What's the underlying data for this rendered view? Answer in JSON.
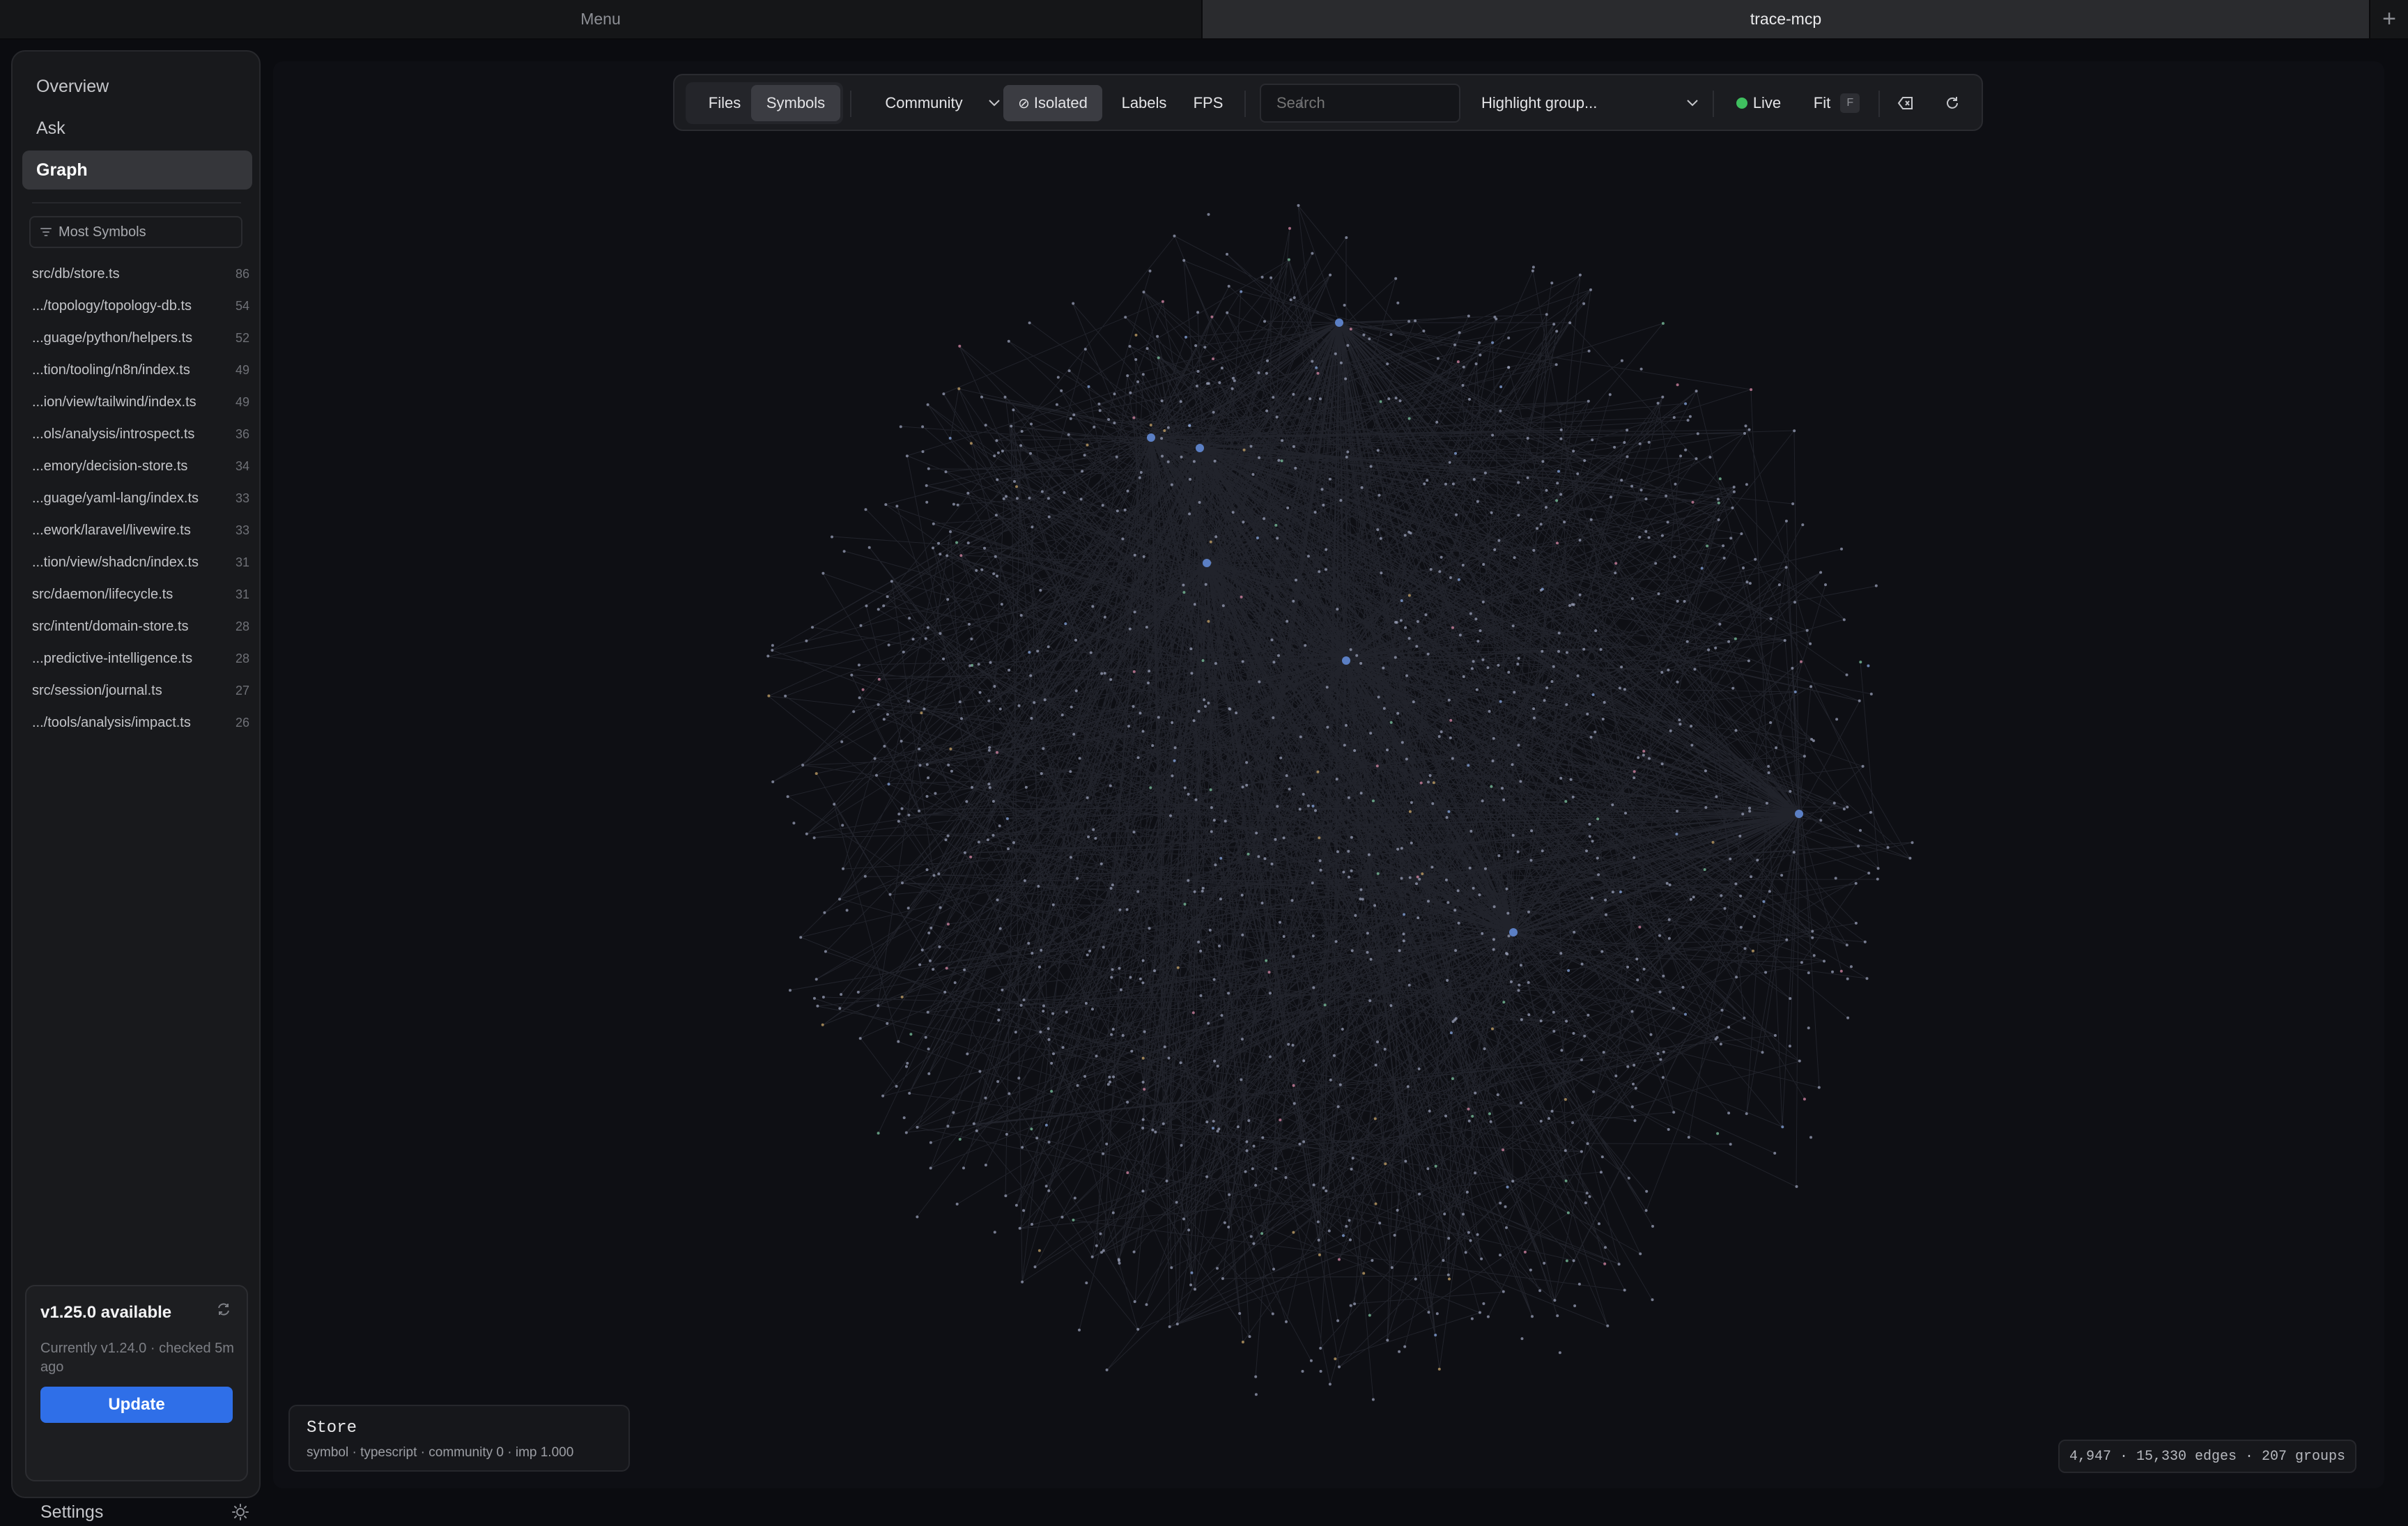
{
  "tabs": {
    "menu": "Menu",
    "active": "trace-mcp",
    "add": "+"
  },
  "sidebar": {
    "nav": [
      {
        "label": "Overview"
      },
      {
        "label": "Ask"
      },
      {
        "label": "Graph"
      }
    ],
    "sort_label": "Most Symbols",
    "files": [
      {
        "path": "src/db/store.ts",
        "count": "86"
      },
      {
        "path": ".../topology/topology-db.ts",
        "count": "54"
      },
      {
        "path": "...guage/python/helpers.ts",
        "count": "52"
      },
      {
        "path": "...tion/tooling/n8n/index.ts",
        "count": "49"
      },
      {
        "path": "...ion/view/tailwind/index.ts",
        "count": "49"
      },
      {
        "path": "...ols/analysis/introspect.ts",
        "count": "36"
      },
      {
        "path": "...emory/decision-store.ts",
        "count": "34"
      },
      {
        "path": "...guage/yaml-lang/index.ts",
        "count": "33"
      },
      {
        "path": "...ework/laravel/livewire.ts",
        "count": "33"
      },
      {
        "path": "...tion/view/shadcn/index.ts",
        "count": "31"
      },
      {
        "path": "src/daemon/lifecycle.ts",
        "count": "31"
      },
      {
        "path": "src/intent/domain-store.ts",
        "count": "28"
      },
      {
        "path": "...predictive-intelligence.ts",
        "count": "28"
      },
      {
        "path": "src/session/journal.ts",
        "count": "27"
      },
      {
        "path": ".../tools/analysis/impact.ts",
        "count": "26"
      }
    ],
    "update": {
      "title": "v1.25.0 available",
      "subtitle": "Currently v1.24.0 · checked 5m ago",
      "button": "Update",
      "refresh_icon": "refresh-icon"
    },
    "settings_label": "Settings"
  },
  "toolbar": {
    "files": "Files",
    "symbols": "Symbols",
    "community": "Community",
    "isolated": "Isolated",
    "labels": "Labels",
    "fps": "FPS",
    "search_placeholder": "Search",
    "search_shortcut": "/",
    "highlight": "Highlight group...",
    "live": "Live",
    "fit": "Fit",
    "fit_shortcut": "F"
  },
  "graph": {
    "background": "#0e0f14",
    "edge_color": "#8a90a8",
    "node_color": "#9aa0b8",
    "hub_color": "#5b7fc4",
    "accent_colors": [
      "#d88aa8",
      "#c8a66a",
      "#7ec6a0",
      "#8aa8e0"
    ]
  },
  "node_info": {
    "name": "Store",
    "meta": "symbol · typescript · community 0 · imp 1.000"
  },
  "stats": "4,947 · 15,330 edges · 207 groups"
}
